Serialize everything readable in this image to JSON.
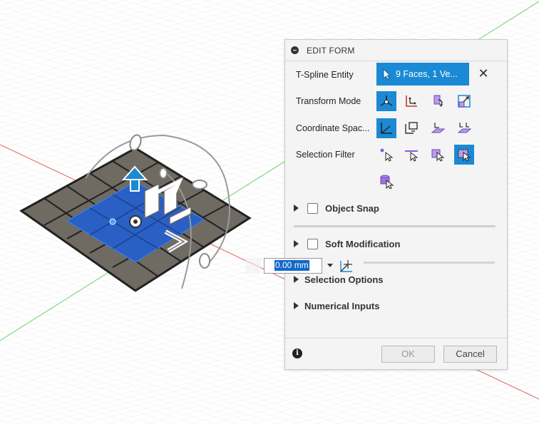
{
  "panel": {
    "title": "EDIT FORM",
    "tspline_label": "T-Spline Entity",
    "tspline_value": "9 Faces, 1 Ve...",
    "transform_mode_label": "Transform Mode",
    "coordinate_space_label": "Coordinate Spac...",
    "selection_filter_label": "Selection Filter",
    "object_snap_label": "Object Snap",
    "soft_modification_label": "Soft Modification",
    "selection_options_label": "Selection Options",
    "numerical_inputs_label": "Numerical Inputs",
    "ok_label": "OK",
    "cancel_label": "Cancel"
  },
  "numeric_input": {
    "value": "0.00 mm"
  },
  "icons": {
    "close": "close-icon",
    "info": "info-icon",
    "expand": "triangle-right-icon"
  },
  "colors": {
    "accent": "#1a8ad4",
    "selection_highlight": "#1268c9",
    "face_selected": "#2a5fc4",
    "face_unselected": "#6f6a62",
    "icon_purple": "#8a5cd6"
  }
}
